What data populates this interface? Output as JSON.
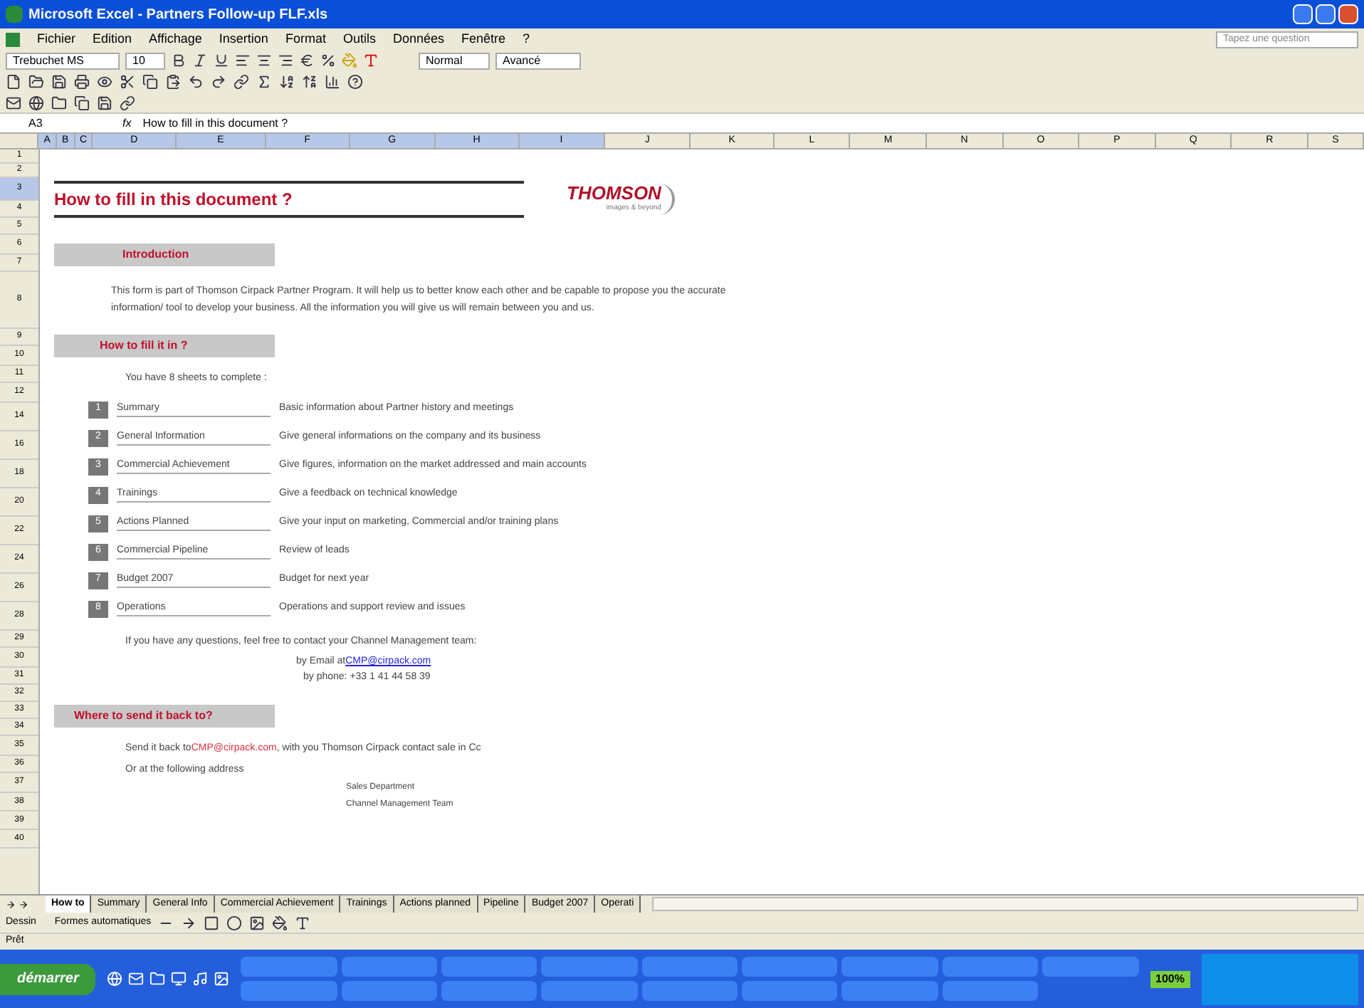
{
  "window": {
    "title": "Microsoft Excel - Partners Follow-up FLF.xls"
  },
  "menu": [
    "Fichier",
    "Edition",
    "Affichage",
    "Insertion",
    "Format",
    "Outils",
    "Données",
    "Fenêtre",
    "?"
  ],
  "help_search": {
    "placeholder": "Tapez une question"
  },
  "format_toolbar": {
    "font": "Trebuchet MS",
    "size": "10",
    "style": "Normal",
    "style2": "Avancé"
  },
  "formula_bar": {
    "name_box": "A3",
    "fx": "fx",
    "value": "How to fill in this document ?"
  },
  "columns": [
    {
      "label": "A",
      "selected": true
    },
    {
      "label": "B",
      "selected": true
    },
    {
      "label": "C",
      "selected": true
    },
    {
      "label": "D",
      "selected": true
    },
    {
      "label": "E",
      "selected": true
    },
    {
      "label": "F",
      "selected": true
    },
    {
      "label": "G",
      "selected": true
    },
    {
      "label": "H",
      "selected": true
    },
    {
      "label": "I",
      "selected": true
    },
    {
      "label": "J",
      "selected": false
    },
    {
      "label": "K",
      "selected": false
    },
    {
      "label": "L",
      "selected": false
    },
    {
      "label": "M",
      "selected": false
    },
    {
      "label": "N",
      "selected": false
    },
    {
      "label": "O",
      "selected": false
    },
    {
      "label": "P",
      "selected": false
    },
    {
      "label": "Q",
      "selected": false
    },
    {
      "label": "R",
      "selected": false
    },
    {
      "label": "S",
      "selected": false
    }
  ],
  "rows": [
    {
      "label": "1",
      "selected": false
    },
    {
      "label": "2",
      "selected": false
    },
    {
      "label": "3",
      "selected": true
    },
    {
      "label": "4",
      "selected": false
    },
    {
      "label": "5",
      "selected": false
    },
    {
      "label": "6",
      "selected": false
    },
    {
      "label": "7",
      "selected": false
    },
    {
      "label": "8",
      "selected": false
    },
    {
      "label": "9",
      "selected": false
    },
    {
      "label": "10",
      "selected": false
    },
    {
      "label": "11",
      "selected": false
    },
    {
      "label": "12",
      "selected": false
    },
    {
      "label": "14",
      "selected": false
    },
    {
      "label": "16",
      "selected": false
    },
    {
      "label": "18",
      "selected": false
    },
    {
      "label": "20",
      "selected": false
    },
    {
      "label": "22",
      "selected": false
    },
    {
      "label": "24",
      "selected": false
    },
    {
      "label": "26",
      "selected": false
    },
    {
      "label": "28",
      "selected": false
    },
    {
      "label": "29",
      "selected": false
    },
    {
      "label": "30",
      "selected": false
    },
    {
      "label": "31",
      "selected": false
    },
    {
      "label": "32",
      "selected": false
    },
    {
      "label": "33",
      "selected": false
    },
    {
      "label": "34",
      "selected": false
    },
    {
      "label": "35",
      "selected": false
    },
    {
      "label": "36",
      "selected": false
    },
    {
      "label": "37",
      "selected": false
    },
    {
      "label": "38",
      "selected": false
    },
    {
      "label": "39",
      "selected": false
    },
    {
      "label": "40",
      "selected": false
    }
  ],
  "sheet": {
    "title": "How to fill in this document ?",
    "logo": "THOMSON",
    "logo_tagline": "images & beyond",
    "intro_heading": "Introduction",
    "intro_text": "This form is part of Thomson Cirpack Partner Program. It will help us to better know each other and be capable to propose you the accurate information/ tool to develop your business. All the information you will give us will remain between you and us.",
    "how_heading": "How to fill it in ?",
    "how_text": "You have 8 sheets to complete :",
    "items": [
      {
        "number": "1",
        "name": "Summary",
        "description": "Basic information about Partner history and meetings"
      },
      {
        "number": "2",
        "name": "General Information",
        "description": "Give general informations on the company and its business"
      },
      {
        "number": "3",
        "name": "Commercial Achievement",
        "description": "Give figures, information on the market addressed and main accounts"
      },
      {
        "number": "4",
        "name": "Trainings",
        "description": "Give a feedback on technical knowledge"
      },
      {
        "number": "5",
        "name": "Actions Planned",
        "description": "Give your input on marketing, Commercial and/or training plans"
      },
      {
        "number": "6",
        "name": "Commercial Pipeline",
        "description": "Review of leads"
      },
      {
        "number": "7",
        "name": "Budget 2007",
        "description": "Budget for next year"
      },
      {
        "number": "8",
        "name": "Operations",
        "description": "Operations and support review and issues"
      }
    ],
    "questions": "If you have any questions, feel free to contact your Channel Management team:",
    "email_prefix": "by Email at ",
    "email": "CMP@cirpack.com",
    "phone": "by phone: +33 1 41 44 58 39",
    "send_heading": "Where to send it back to?",
    "send_prefix": "Send it back to ",
    "send_email": "CMP@cirpack.com",
    "send_suffix": ", with you Thomson Cirpack contact sale in Cc",
    "address_intro": "Or at the following address",
    "address": [
      "Sales Department",
      "Channel Management Team"
    ]
  },
  "sheet_tabs": [
    {
      "label": "How to",
      "selected": true
    },
    {
      "label": "Summary",
      "selected": false
    },
    {
      "label": "General Info",
      "selected": false
    },
    {
      "label": "Commercial Achievement",
      "selected": false
    },
    {
      "label": "Trainings",
      "selected": false
    },
    {
      "label": "Actions planned",
      "selected": false
    },
    {
      "label": "Pipeline",
      "selected": false
    },
    {
      "label": "Budget 2007",
      "selected": false
    },
    {
      "label": "Operati",
      "selected": false
    }
  ],
  "drawing_toolbar": {
    "draw": "Dessin",
    "autoshapes": "Formes automatiques"
  },
  "status_bar": "Prêt",
  "taskbar": {
    "start": "démarrer",
    "zoom": "100%"
  }
}
